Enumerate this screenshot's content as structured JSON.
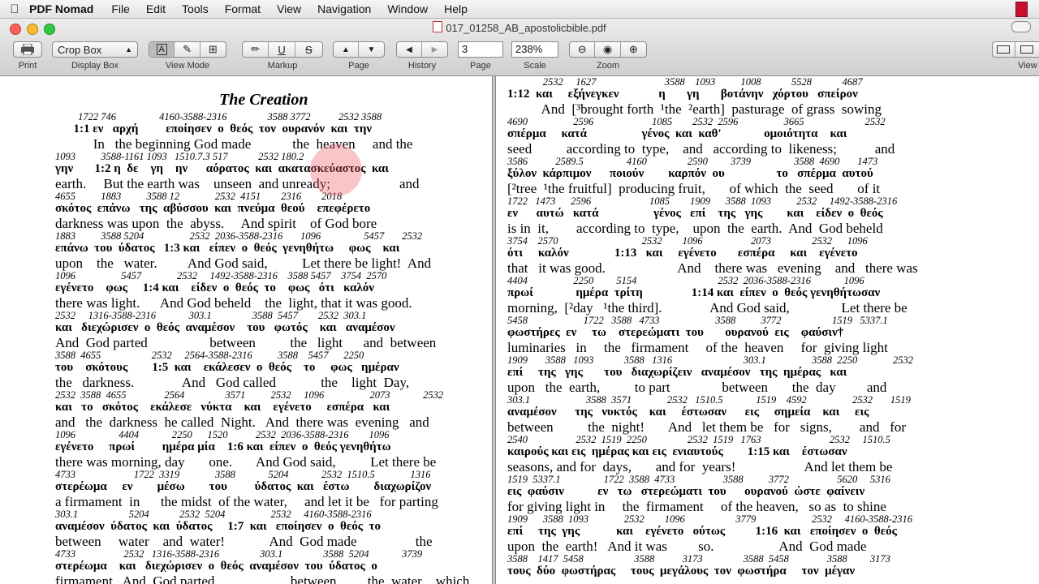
{
  "menubar": {
    "app": "PDF Nomad",
    "items": [
      "File",
      "Edit",
      "Tools",
      "Format",
      "View",
      "Navigation",
      "Window",
      "Help"
    ]
  },
  "window": {
    "title": "017_01258_AB_apostolicbible.pdf"
  },
  "toolbar": {
    "print_label": "Print",
    "display_box": {
      "value": "Crop Box",
      "label": "Display Box"
    },
    "view_mode_label": "View Mode",
    "markup_label": "Markup",
    "page_label": "Page",
    "history_label": "History",
    "page_number": "3",
    "scale": {
      "value": "238%",
      "label": "Scale"
    },
    "zoom_label": "Zoom",
    "view_label": "View"
  },
  "document": {
    "heading": "The Creation",
    "left_lines": [
      {
        "n": "         1722 746                 4160-3588-2316                3588 3772           2532 3588",
        "g": "      1:1 εν   αρχή         εποίησεν  ο  θεός  τον  ουρανόν  και  την",
        "e": "           In   the beginning God made            the  heaven     and the"
      },
      {
        "n": "1093          3588-1161 1093   1510.7.3 517            2532 180.2",
        "g": "γην       1:2 η  δε    γη    ην      αόρατος  και  ακατασκεύαστος  και",
        "e": "earth.     But the earth was    unseen  and unready;                    and"
      },
      {
        "n": "4655          1883          3588 12              2532  4151        2316        2018",
        "g": "σκότος  επάνω   της  αβύσσου  και  πνεύμα  θεού    επεφέρετο",
        "e": "darkness was upon  the  abyss.     And spirit    of God bore"
      },
      {
        "n": "1883          3588 5204                  2532  2036-3588-2316       1096                 5457       2532",
        "g": "επάνω  του  ύδατος   1:3 και   είπεν  ο  θεός  γενηθήτω     φως    και",
        "e": "upon    the   water.         And God said,          Let there be light!  And"
      },
      {
        "n": "1096                  5457              2532     1492-3588-2316    3588 5457    3754  2570",
        "g": "εγένετο    φως     1:4 και    είδεν  ο  θεός  το    φως   ότι   καλόν",
        "e": "there was light.      And God beheld    the  light, that it was good."
      },
      {
        "n": "2532     1316-3588-2316             303.1                3588  5457        2532  303.1",
        "g": "και   διεχώρισεν  ο  θεός  αναμέσον    του   φωτός    και   αναμέσον",
        "e": "And  God parted                  between          the   light      and  between"
      },
      {
        "n": "3588  4655                    2532     2564-3588-2316          3588    5457      2250",
        "g": "του    σκότους        1:5  και    εκάλεσεν  ο  θεός    το     φως   ημέραν",
        "e": "the   darkness.              And   God called             the    light  Day,"
      },
      {
        "n": "2532  3588  4655               2564                3571          2532     1096                  2073             2532",
        "g": "και   το   σκότος    εκάλεσε   νύκτα    και    εγένετο     εσπέρα   και",
        "e": "and   the  darkness  he called  Night.   And  there was  evening   and"
      },
      {
        "n": "1096                 4404             2250      1520           2532  2036-3588-2316        1096",
        "g": "εγένετο     πρωί         ημέρα μία    1:6 και  είπεν  ο  θεός γενηθήτω",
        "e": "there was morning, day       one.       And God said,          Let there be"
      },
      {
        "n": "4733                       1722  3319              3588             5204             2532  1510.5              1316",
        "g": "στερέωμα     εν        μέσω        του         ύδατος  και   έστω        διαχωρίζον",
        "e": "a firmament  in      the midst  of the water,     and let it be   for parting"
      },
      {
        "n": "303.1                    5204            2532  5204                  2532     4160-3588-2316",
        "g": "αναμέσον  ύδατος  και  ύδατος     1:7  και   εποίησεν  ο  θεός  το",
        "e": "between     water    and  water!             And  God made                 the"
      },
      {
        "n": "4733                   2532   1316-3588-2316                303.1                3588  5204             3739",
        "g": "στερέωμα    και   διεχώρισεν  ο  θεός  αναμέσον  του  ύδατος  ο",
        "e": "firmament.  And  God parted                      between         the  water    which"
      }
    ],
    "right_lines": [
      {
        "n": "              2532     1627                           3588    1093          1008            5528            4687",
        "g": "1:12  και     εξήνεγκεν             η       γη       βοτάνην   χόρτου   σπείρον",
        "e": "          And  [³brought forth  ¹the  ²earth]  pasturage  of grass  sowing"
      },
      {
        "n": "4690                  2596                       1085        2532  2596                  3665                        2532",
        "g": "σπέρμα     κατά                  γένος  και  καθ'              ομοιότητα    και",
        "e": "seed          according to  type,    and   according to  likeness;           and"
      },
      {
        "n": "3586           2589.5                 4160                2590         3739                 3588  4690       1473",
        "g": "ξύλον  κάρπιμον      ποιούν        καρπόν  ου                 το   σπέρμα  αυτού",
        "e": "[²tree  ¹the fruitful]  producing fruit,       of which  the  seed       of it"
      },
      {
        "n": "1722   1473      2596                       1085        1909      3588  1093          2532     1492-3588-2316",
        "g": "εν      αυτώ   κατά                  γένος   επί    της   γης        και    είδεν  ο  θεός",
        "e": "is in  it,        according to  type,    upon  the  earth.  And  God beheld"
      },
      {
        "n": "3754    2570                                 2532        1096                   2073                2532      1096",
        "g": "ότι     καλόν               1:13   και     εγένετο       εσπέρα     και    εγένετο",
        "e": "that   it was good.                     And    there was   evening    and   there was"
      },
      {
        "n": "4404                  2250         5154                                2532  2036-3588-2316             1096",
        "g": "πρωί              ημέρα  τρίτη                1:14 και  είπεν  ο  θεός γενηθήτωσαν",
        "e": "morning,  [²day   ¹the third].              And God said,               Let there be"
      },
      {
        "n": "5458                      1722   3588   4733                      3588          3772                    1519   5337.1",
        "g": "φωστήρες  εν     τω    στερεώματι  του       ουρανού  εις    φαύσιν†",
        "e": "luminaries   in     the   firmament     of the  heaven     for  giving light"
      },
      {
        "n": "1909       3588   1093            3588   1316                            303.1                  3588  2250              2532",
        "g": "επί     της   γης       του   διαχωρίζειν   αναμέσον   της  ημέρας   και",
        "e": "upon   the  earth,          to part               between       the  day         and"
      },
      {
        "n": "303.1                      3588  3571              2532   1510.5             1519    4592                  2532       1519",
        "g": "αναμέσον      της   νυκτός    και     έστωσαν      εις     σημεία    και     εις",
        "e": "between          the  night!       And   let them be   for   signs,        and   for"
      },
      {
        "n": "2540                   2532  1519  2250                2532  1519   1763                           2532     1510.5",
        "g": "καιρούς και εις  ημέρας και εις  ενιαυτούς        1:15 και    έστωσαν",
        "e": "seasons, and for  days,       and for  years!                    And let them be"
      },
      {
        "n": "1519  5337.1                 1722  3588  4733                   3588          3772                   5620     5316",
        "g": "εις  φαύσιν           εν   τω   στερεώματι  του      ουρανού  ώστε  φαίνειν",
        "e": "for giving light in     the  firmament     of the heaven,   so as  to shine"
      },
      {
        "n": "1909      3588  1093              2532        1096                    3779                      2532     4160-3588-2316",
        "g": "επί     της  γης            και    εγένετο   ούτως          1:16  και   εποίησεν  ο  θεός",
        "e": "upon  the  earth!   And it was         so.                   And  God made"
      },
      {
        "n": "3588    1417  5458                    3588           3173                3588  5458               3588         3173",
        "g": "τους  δύο  φωστήρας     τους  μεγάλους  τον  φωστήρα     τον  μέγαν",
        "e": ""
      }
    ]
  }
}
